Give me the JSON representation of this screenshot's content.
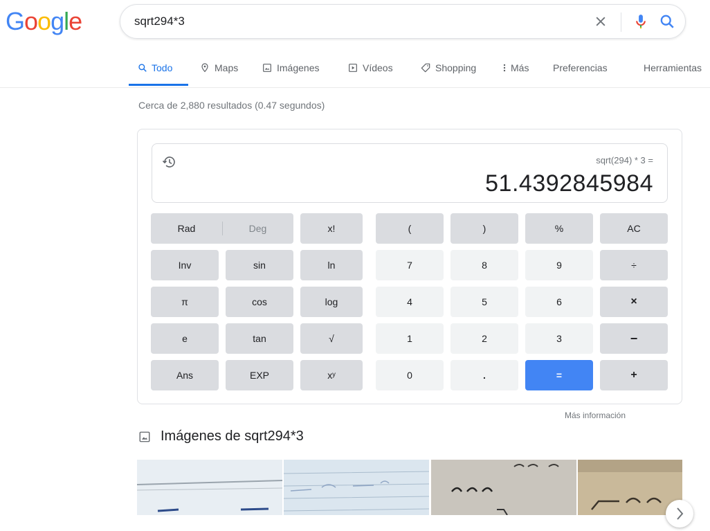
{
  "logo": {
    "letters": [
      "G",
      "o",
      "o",
      "g",
      "l",
      "e"
    ]
  },
  "search": {
    "query": "sqrt294*3"
  },
  "tabs": [
    {
      "label": "Todo",
      "icon": "search-icon"
    },
    {
      "label": "Maps",
      "icon": "map-pin-icon"
    },
    {
      "label": "Imágenes",
      "icon": "image-icon"
    },
    {
      "label": "Vídeos",
      "icon": "video-icon"
    },
    {
      "label": "Shopping",
      "icon": "tag-icon"
    },
    {
      "label": "Más",
      "icon": "more-vert-icon"
    },
    {
      "label": "Preferencias"
    },
    {
      "label": "Herramientas"
    }
  ],
  "result_stats": "Cerca de 2,880 resultados (0.47 segundos)",
  "calculator": {
    "expression": "sqrt(294) * 3 =",
    "result": "51.4392845984",
    "keys": {
      "rad": "Rad",
      "deg": "Deg",
      "fact": "x!",
      "lparen": "(",
      "rparen": ")",
      "pct": "%",
      "ac": "AC",
      "inv": "Inv",
      "sin": "sin",
      "ln": "ln",
      "k7": "7",
      "k8": "8",
      "k9": "9",
      "div": "÷",
      "pi": "π",
      "cos": "cos",
      "log": "log",
      "k4": "4",
      "k5": "5",
      "k6": "6",
      "mul": "×",
      "e": "e",
      "tan": "tan",
      "sqrt": "√",
      "k1": "1",
      "k2": "2",
      "k3": "3",
      "sub": "−",
      "ans": "Ans",
      "exp": "EXP",
      "pow": "xʸ",
      "k0": "0",
      "dot": ".",
      "eq": "=",
      "add": "+"
    }
  },
  "more_info": "Más información",
  "images_section": {
    "title": "Imágenes de sqrt294*3"
  },
  "colors": {
    "accent": "#1a73e8",
    "equals": "#4285f4"
  }
}
